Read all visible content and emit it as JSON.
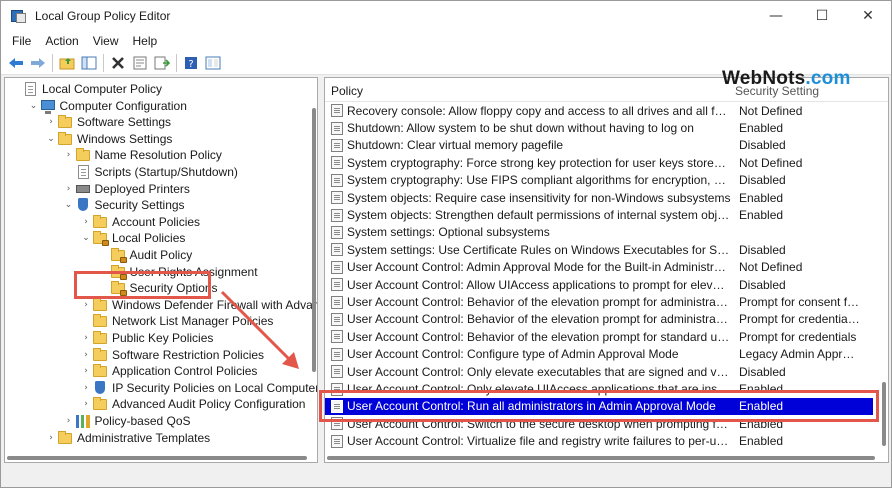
{
  "window": {
    "title": "Local Group Policy Editor",
    "controls": {
      "minimize": "—",
      "maximize": "☐",
      "close": "✕"
    }
  },
  "menu": [
    "File",
    "Action",
    "View",
    "Help"
  ],
  "toolbar_icons": [
    "back-arrow-icon",
    "forward-arrow-icon",
    "up-folder-icon",
    "show-hide-tree-icon",
    "delete-icon",
    "properties-icon",
    "export-list-icon",
    "help-icon",
    "extended-view-icon"
  ],
  "tree": [
    {
      "label": "Local Computer Policy",
      "icon": "document",
      "depth": 0,
      "chev": ""
    },
    {
      "label": "Computer Configuration",
      "icon": "computer",
      "depth": 1,
      "chev": "down"
    },
    {
      "label": "Software Settings",
      "icon": "folder",
      "depth": 2,
      "chev": "right"
    },
    {
      "label": "Windows Settings",
      "icon": "folder",
      "depth": 2,
      "chev": "down"
    },
    {
      "label": "Name Resolution Policy",
      "icon": "folder",
      "depth": 3,
      "chev": "right"
    },
    {
      "label": "Scripts (Startup/Shutdown)",
      "icon": "document",
      "depth": 3,
      "chev": ""
    },
    {
      "label": "Deployed Printers",
      "icon": "printer",
      "depth": 3,
      "chev": "right"
    },
    {
      "label": "Security Settings",
      "icon": "shield",
      "depth": 3,
      "chev": "down"
    },
    {
      "label": "Account Policies",
      "icon": "folder",
      "depth": 4,
      "chev": "right"
    },
    {
      "label": "Local Policies",
      "icon": "lockfolder",
      "depth": 4,
      "chev": "down"
    },
    {
      "label": "Audit Policy",
      "icon": "lockfolder",
      "depth": 5,
      "chev": ""
    },
    {
      "label": "User Rights Assignment",
      "icon": "lockfolder",
      "depth": 5,
      "chev": ""
    },
    {
      "label": "Security Options",
      "icon": "lockfolder",
      "depth": 5,
      "chev": ""
    },
    {
      "label": "Windows Defender Firewall with Advanced S",
      "icon": "folder",
      "depth": 4,
      "chev": "right"
    },
    {
      "label": "Network List Manager Policies",
      "icon": "folder",
      "depth": 4,
      "chev": ""
    },
    {
      "label": "Public Key Policies",
      "icon": "folder",
      "depth": 4,
      "chev": "right"
    },
    {
      "label": "Software Restriction Policies",
      "icon": "folder",
      "depth": 4,
      "chev": "right"
    },
    {
      "label": "Application Control Policies",
      "icon": "folder",
      "depth": 4,
      "chev": "right"
    },
    {
      "label": "IP Security Policies on Local Computer",
      "icon": "shield",
      "depth": 4,
      "chev": "right"
    },
    {
      "label": "Advanced Audit Policy Configuration",
      "icon": "folder",
      "depth": 4,
      "chev": "right"
    },
    {
      "label": "Policy-based QoS",
      "icon": "bars",
      "depth": 3,
      "chev": "right"
    },
    {
      "label": "Administrative Templates",
      "icon": "folder",
      "depth": 2,
      "chev": "right"
    }
  ],
  "list": {
    "header": {
      "policy": "Policy",
      "setting": "Security Setting"
    },
    "rows": [
      {
        "policy": "Recovery console: Allow floppy copy and access to all drives and all folders",
        "setting": "Not Defined"
      },
      {
        "policy": "Shutdown: Allow system to be shut down without having to log on",
        "setting": "Enabled"
      },
      {
        "policy": "Shutdown: Clear virtual memory pagefile",
        "setting": "Disabled"
      },
      {
        "policy": "System cryptography: Force strong key protection for user keys stored on the computer",
        "setting": "Not Defined"
      },
      {
        "policy": "System cryptography: Use FIPS compliant algorithms for encryption, hashing, and signing",
        "setting": "Disabled"
      },
      {
        "policy": "System objects: Require case insensitivity for non-Windows subsystems",
        "setting": "Enabled"
      },
      {
        "policy": "System objects: Strengthen default permissions of internal system objects (e.g. Symbolic Links)",
        "setting": "Enabled"
      },
      {
        "policy": "System settings: Optional subsystems",
        "setting": ""
      },
      {
        "policy": "System settings: Use Certificate Rules on Windows Executables for Software Restriction Policies",
        "setting": "Disabled"
      },
      {
        "policy": "User Account Control: Admin Approval Mode for the Built-in Administrator account",
        "setting": "Not Defined"
      },
      {
        "policy": "User Account Control: Allow UIAccess applications to prompt for elevation without using the secure desktop",
        "setting": "Disabled"
      },
      {
        "policy": "User Account Control: Behavior of the elevation prompt for administrators in Admin Approval Mode",
        "setting": "Prompt for consent for non-Windows binaries"
      },
      {
        "policy": "User Account Control: Behavior of the elevation prompt for administrators running with Administrator protection",
        "setting": "Prompt for credentials on the secure desktop"
      },
      {
        "policy": "User Account Control: Behavior of the elevation prompt for standard users",
        "setting": "Prompt for credentials"
      },
      {
        "policy": "User Account Control: Configure type of Admin Approval Mode",
        "setting": "Legacy Admin Approval Mode"
      },
      {
        "policy": "User Account Control: Only elevate executables that are signed and validated",
        "setting": "Disabled"
      },
      {
        "policy": "User Account Control: Only elevate UIAccess applications that are installed in secure locations",
        "setting": "Enabled"
      },
      {
        "policy": "User Account Control: Run all administrators in Admin Approval Mode",
        "setting": "Enabled",
        "selected": true
      },
      {
        "policy": "User Account Control: Switch to the secure desktop when prompting for elevation",
        "setting": "Enabled"
      },
      {
        "policy": "User Account Control: Virtualize file and registry write failures to per-user locations",
        "setting": "Enabled"
      }
    ]
  },
  "watermark": {
    "part1": "WebNots",
    "part2": ".com"
  },
  "colors": {
    "selection": "#0000d8",
    "highlight": "#e3574a",
    "folder": "#f4cd5c"
  }
}
